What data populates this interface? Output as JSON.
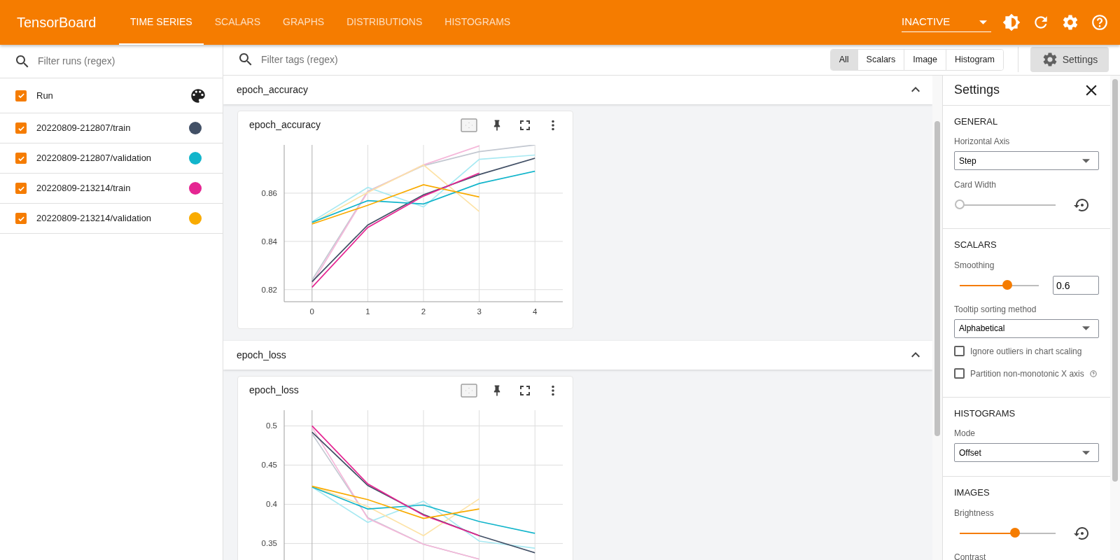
{
  "header": {
    "brand": "TensorBoard",
    "tabs": [
      {
        "label": "TIME SERIES",
        "selected": true
      },
      {
        "label": "SCALARS",
        "selected": false
      },
      {
        "label": "GRAPHS",
        "selected": false
      },
      {
        "label": "DISTRIBUTIONS",
        "selected": false
      },
      {
        "label": "HISTOGRAMS",
        "selected": false
      }
    ],
    "run_selector": "INACTIVE"
  },
  "runs": {
    "filter_placeholder": "Filter runs (regex)",
    "header": {
      "label": "Run",
      "checked": true
    },
    "items": [
      {
        "label": "20220809-212807/train",
        "checked": true,
        "color": "#425066"
      },
      {
        "label": "20220809-212807/validation",
        "checked": true,
        "color": "#12b5cb"
      },
      {
        "label": "20220809-213214/train",
        "checked": true,
        "color": "#e52592"
      },
      {
        "label": "20220809-213214/validation",
        "checked": true,
        "color": "#f9ab00"
      }
    ]
  },
  "toolbar": {
    "filter_placeholder": "Filter tags (regex)",
    "type_filters": [
      {
        "label": "All",
        "selected": true
      },
      {
        "label": "Scalars",
        "selected": false
      },
      {
        "label": "Image",
        "selected": false
      },
      {
        "label": "Histogram",
        "selected": false
      }
    ],
    "settings_button": {
      "label": "Settings",
      "selected": true
    }
  },
  "groups": [
    {
      "title": "epoch_accuracy",
      "expanded": true,
      "cards": [
        {
          "title": "epoch_accuracy",
          "chart_data": {
            "type": "line",
            "x": [
              0,
              1,
              2,
              3,
              4
            ],
            "xlim": [
              -0.5,
              4.5
            ],
            "ylim": [
              0.815,
              0.88
            ],
            "grid": true,
            "xticks": [
              {
                "value": 0,
                "label": "0"
              },
              {
                "value": 1,
                "label": "1"
              },
              {
                "value": 2,
                "label": "2"
              },
              {
                "value": 3,
                "label": "3"
              },
              {
                "value": 4,
                "label": "4"
              }
            ],
            "yticks": [
              {
                "value": 0.82,
                "label": "0.82"
              },
              {
                "value": 0.84,
                "label": "0.84"
              },
              {
                "value": 0.86,
                "label": "0.86"
              }
            ],
            "series": [
              {
                "color": "#c3c8d1",
                "values": [
                  0.824,
                  0.8608,
                  0.8714,
                  0.8772,
                  0.88
                ]
              },
              {
                "color": "#a8e9f2",
                "values": [
                  0.8482,
                  0.8624,
                  0.8543,
                  0.874,
                  0.8758
                ]
              },
              {
                "color": "#f5b8da",
                "values": [
                  0.8226,
                  0.8605,
                  0.8717,
                  0.8796,
                  null
                ]
              },
              {
                "color": "#fde3a7",
                "values": [
                  0.8475,
                  0.8603,
                  0.8717,
                  0.8524,
                  null
                ]
              },
              {
                "color": "#425066",
                "values": [
                  0.8233,
                  0.8468,
                  0.8593,
                  0.8677,
                  0.8745
                ]
              },
              {
                "color": "#12b5cb",
                "values": [
                  0.8479,
                  0.8569,
                  0.8555,
                  0.864,
                  0.8691
                ]
              },
              {
                "color": "#e52592",
                "values": [
                  0.821,
                  0.8458,
                  0.8588,
                  0.8683,
                  null
                ]
              },
              {
                "color": "#f9ab00",
                "values": [
                  0.8472,
                  0.855,
                  0.8635,
                  0.8584,
                  null
                ]
              }
            ]
          }
        }
      ]
    },
    {
      "title": "epoch_loss",
      "expanded": true,
      "cards": [
        {
          "title": "epoch_loss",
          "chart_data": {
            "type": "line",
            "x": [
              0,
              1,
              2,
              3,
              4
            ],
            "xlim": [
              -0.5,
              4.5
            ],
            "ylim": [
              0.32,
              0.52
            ],
            "grid": true,
            "yticks": [
              {
                "value": 0.35,
                "label": "0.35"
              },
              {
                "value": 0.4,
                "label": "0.4"
              },
              {
                "value": 0.45,
                "label": "0.45"
              },
              {
                "value": 0.5,
                "label": "0.5"
              }
            ],
            "series": [
              {
                "color": "#c3c8d1",
                "values": [
                  0.49,
                  0.383,
                  0.349,
                  0.33,
                  null
                ]
              },
              {
                "color": "#a8e9f2",
                "values": [
                  0.422,
                  0.377,
                  0.404,
                  0.353,
                  0.344
                ]
              },
              {
                "color": "#f5b8da",
                "values": [
                  0.498,
                  0.382,
                  0.349,
                  0.33,
                  null
                ]
              },
              {
                "color": "#fde3a7",
                "values": [
                  0.423,
                  0.397,
                  0.36,
                  0.407,
                  null
                ]
              },
              {
                "color": "#425066",
                "values": [
                  0.492,
                  0.424,
                  0.387,
                  0.36,
                  0.338
                ]
              },
              {
                "color": "#12b5cb",
                "values": [
                  0.422,
                  0.394,
                  0.399,
                  0.378,
                  0.363
                ]
              },
              {
                "color": "#e52592",
                "values": [
                  0.5,
                  0.426,
                  0.386,
                  0.36,
                  null
                ]
              },
              {
                "color": "#f9ab00",
                "values": [
                  0.423,
                  0.406,
                  0.382,
                  0.394,
                  null
                ]
              }
            ]
          }
        }
      ]
    }
  ],
  "settings": {
    "title": "Settings",
    "sections": [
      {
        "title": "GENERAL",
        "items": [
          {
            "kind": "select",
            "label": "Horizontal Axis",
            "value": "Step"
          },
          {
            "kind": "slider",
            "label": "Card Width",
            "level": 0
          }
        ]
      },
      {
        "title": "SCALARS",
        "items": [
          {
            "kind": "slider",
            "label": "Smoothing",
            "level": 0.6,
            "input_value": "0.6"
          },
          {
            "kind": "select",
            "label": "Tooltip sorting method",
            "value": "Alphabetical"
          },
          {
            "kind": "checkbox",
            "label": "Ignore outliers in chart scaling",
            "checked": false
          },
          {
            "kind": "checkbox",
            "label": "Partition non-monotonic X axis",
            "checked": false,
            "has_help": true
          }
        ]
      },
      {
        "title": "HISTOGRAMS",
        "items": [
          {
            "kind": "select",
            "label": "Mode",
            "value": "Offset"
          }
        ]
      },
      {
        "title": "IMAGES",
        "items": [
          {
            "kind": "slider",
            "label": "Brightness",
            "level": 0.58
          },
          {
            "kind": "label",
            "label": "Contrast"
          }
        ]
      }
    ]
  }
}
